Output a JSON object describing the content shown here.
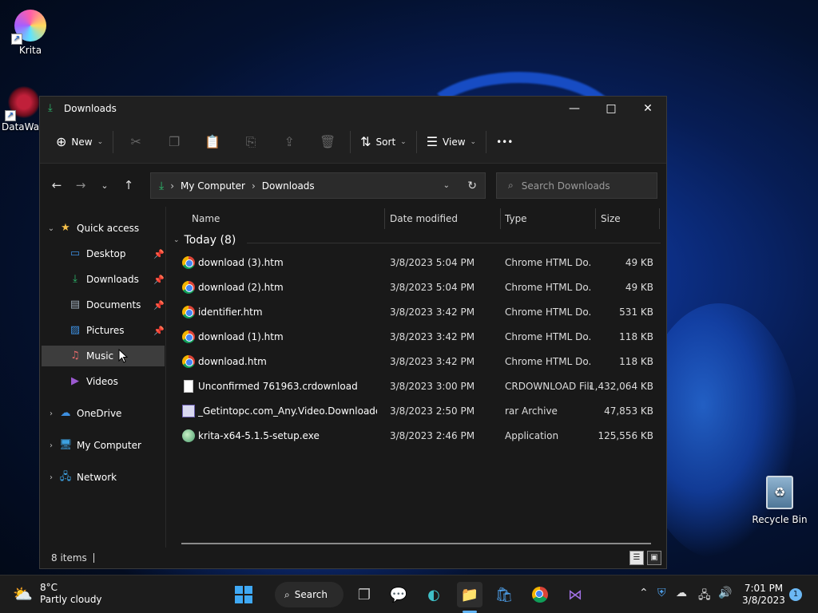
{
  "desktop": {
    "icons": [
      {
        "label": "Krita"
      },
      {
        "label": "DataWag"
      }
    ],
    "recycle_bin": "Recycle Bin"
  },
  "window": {
    "title": "Downloads",
    "controls": {
      "minimize": "—",
      "maximize": "□",
      "close": "✕"
    },
    "commandbar": {
      "new_label": "New",
      "sort_label": "Sort",
      "view_label": "View",
      "more_label": "•••"
    },
    "address": {
      "crumbs": [
        "My Computer",
        "Downloads"
      ]
    },
    "search": {
      "placeholder": "Search Downloads"
    },
    "nav": {
      "quick_access": "Quick access",
      "items": [
        {
          "label": "Desktop",
          "icon": "desktop-icon",
          "color": "#3d8fe0"
        },
        {
          "label": "Downloads",
          "icon": "download-icon",
          "color": "#2dbd6e"
        },
        {
          "label": "Documents",
          "icon": "document-icon",
          "color": "#9aa7b4"
        },
        {
          "label": "Pictures",
          "icon": "pictures-icon",
          "color": "#3d8fe0"
        },
        {
          "label": "Music",
          "icon": "music-icon",
          "color": "#e66a6a"
        },
        {
          "label": "Videos",
          "icon": "videos-icon",
          "color": "#9b59d0"
        }
      ],
      "onedrive": "OneDrive",
      "my_computer": "My Computer",
      "network": "Network"
    },
    "columns": {
      "name": "Name",
      "date": "Date modified",
      "type": "Type",
      "size": "Size"
    },
    "group": {
      "label": "Today (8)"
    },
    "files": [
      {
        "name": "download (3).htm",
        "date": "3/8/2023 5:04 PM",
        "type": "Chrome HTML Do...",
        "size": "49 KB",
        "icon": "chrome"
      },
      {
        "name": "download (2).htm",
        "date": "3/8/2023 5:04 PM",
        "type": "Chrome HTML Do...",
        "size": "49 KB",
        "icon": "chrome"
      },
      {
        "name": "identifier.htm",
        "date": "3/8/2023 3:42 PM",
        "type": "Chrome HTML Do...",
        "size": "531 KB",
        "icon": "chrome"
      },
      {
        "name": "download (1).htm",
        "date": "3/8/2023 3:42 PM",
        "type": "Chrome HTML Do...",
        "size": "118 KB",
        "icon": "chrome"
      },
      {
        "name": "download.htm",
        "date": "3/8/2023 3:42 PM",
        "type": "Chrome HTML Do...",
        "size": "118 KB",
        "icon": "chrome"
      },
      {
        "name": "Unconfirmed 761963.crdownload",
        "date": "3/8/2023 3:00 PM",
        "type": "CRDOWNLOAD File",
        "size": "1,432,064 KB",
        "icon": "doc"
      },
      {
        "name": "_Getintopc.com_Any.Video.Downloader....",
        "date": "3/8/2023 2:50 PM",
        "type": "rar Archive",
        "size": "47,853 KB",
        "icon": "rar"
      },
      {
        "name": "krita-x64-5.1.5-setup.exe",
        "date": "3/8/2023 2:46 PM",
        "type": "Application",
        "size": "125,556 KB",
        "icon": "exe"
      }
    ],
    "status": {
      "count": "8 items"
    }
  },
  "taskbar": {
    "weather": {
      "temp": "8°C",
      "desc": "Partly cloudy"
    },
    "search_label": "Search",
    "clock": {
      "time": "7:01 PM",
      "date": "3/8/2023"
    },
    "notifications": "1"
  }
}
